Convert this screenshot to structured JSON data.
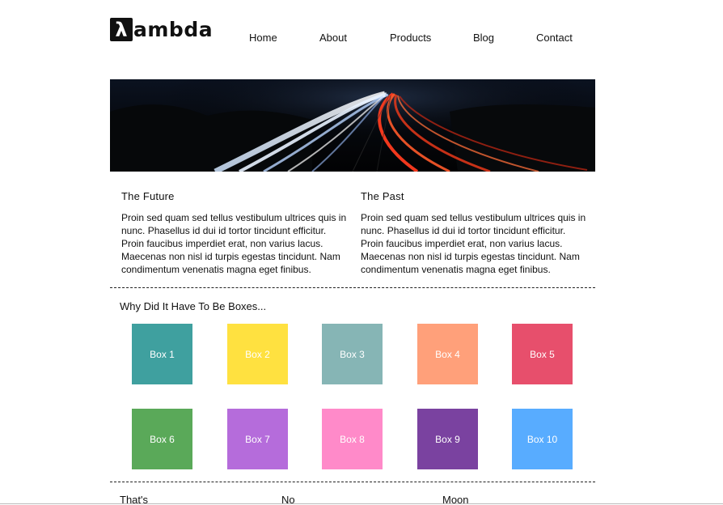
{
  "logo": {
    "mark": "λ",
    "text": "ambda"
  },
  "nav": [
    "Home",
    "About",
    "Products",
    "Blog",
    "Contact"
  ],
  "hero": {
    "icon": "highway-light-trails-image"
  },
  "columns": [
    {
      "title": "The Future",
      "text": "Proin sed quam sed tellus vestibulum ultrices quis in nunc. Phasellus id dui id tortor tincidunt efficitur. Proin faucibus imperdiet erat, non varius lacus. Maecenas non nisl id turpis egestas tincidunt. Nam condimentum venenatis magna eget finibus."
    },
    {
      "title": "The Past",
      "text": "Proin sed quam sed tellus vestibulum ultrices quis in nunc. Phasellus id dui id tortor tincidunt efficitur. Proin faucibus imperdiet erat, non varius lacus. Maecenas non nisl id turpis egestas tincidunt. Nam condimentum venenatis magna eget finibus."
    }
  ],
  "boxes_title": "Why Did It Have To Be Boxes...",
  "boxes": [
    {
      "label": "Box 1",
      "color": "#3fa09f"
    },
    {
      "label": "Box 2",
      "color": "#ffe140"
    },
    {
      "label": "Box 3",
      "color": "#86b5b5"
    },
    {
      "label": "Box 4",
      "color": "#ffa07a"
    },
    {
      "label": "Box 5",
      "color": "#e74f6c"
    },
    {
      "label": "Box 6",
      "color": "#5aa959"
    },
    {
      "label": "Box 7",
      "color": "#b56cdb"
    },
    {
      "label": "Box 8",
      "color": "#ff8ac9"
    },
    {
      "label": "Box 9",
      "color": "#7a42a0"
    },
    {
      "label": "Box 10",
      "color": "#58acff"
    }
  ],
  "footer": [
    "That's",
    "No",
    "Moon"
  ]
}
